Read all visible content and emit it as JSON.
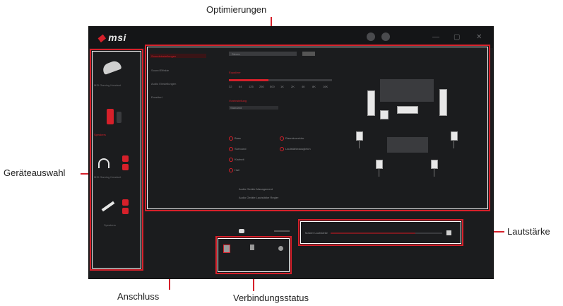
{
  "callouts": {
    "optimizations": "Optimierungen",
    "device_selection": "Geräteauswahl",
    "volume": "Lautstärke",
    "connection": "Anschluss",
    "connection_status": "Verbindungsstatus"
  },
  "app": {
    "logo": "msi",
    "devices": [
      {
        "label": "MSI Gaming Headset"
      },
      {
        "label": "Speakers"
      },
      {
        "label": "MSI Gaming Headset"
      },
      {
        "label": "Speakers"
      }
    ],
    "menu": [
      "Soundeinstellungen",
      "Sound Effekte",
      "Audio Einstellungen",
      "Erweitert"
    ],
    "controls": {
      "select_label": "Stereo",
      "eq_label": "Equalizer",
      "eq_bands": [
        "32",
        "64",
        "125",
        "250",
        "500",
        "1K",
        "2K",
        "4K",
        "8K",
        "16K"
      ],
      "preset_label": "Voreinstellung",
      "preset_value": "Standard",
      "effects_left": [
        "Bass",
        "Surround",
        "Klarheit",
        "Hall"
      ],
      "effects_right": [
        "Raumkorrektur",
        "Lautstärkeausgleich"
      ],
      "option_1": "Audio Geräte Management",
      "option_2": "Audio Geräte Lautstärke Regler"
    },
    "volume_label": "Master Lautstärke",
    "colors": {
      "accent": "#d6202a",
      "bg": "#1b1c1e"
    }
  }
}
